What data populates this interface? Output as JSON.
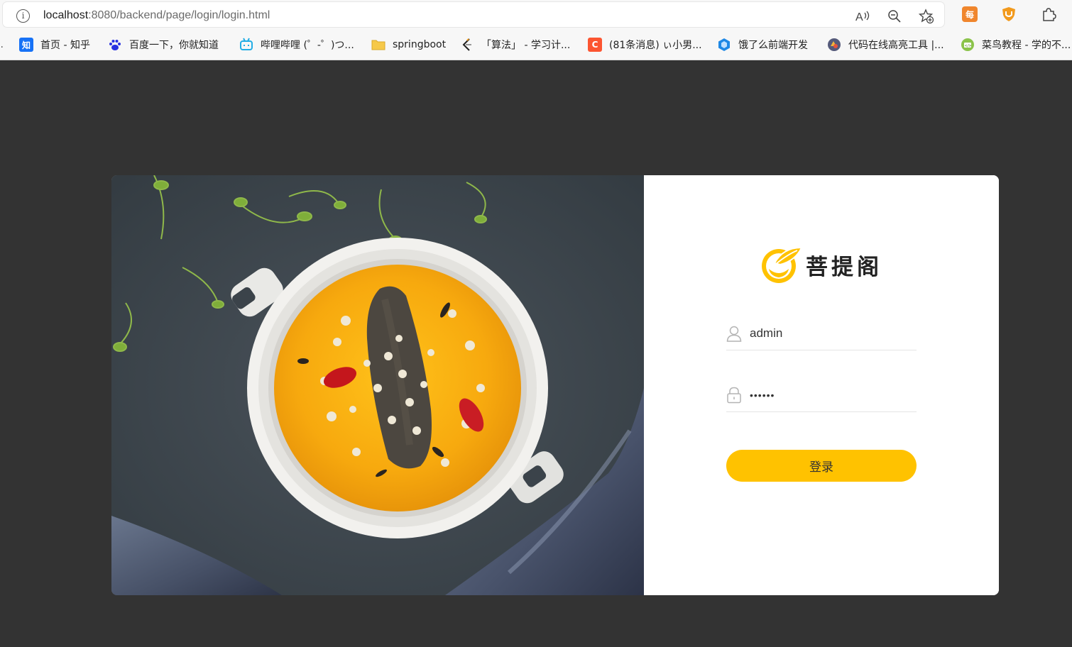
{
  "browser": {
    "url_host": "localhost",
    "url_path": ":8080/backend/page/login/login.html",
    "toolbar_icons": [
      "read-aloud-icon",
      "zoom-out-icon",
      "favorite-add-icon"
    ],
    "extensions": [
      {
        "name": "extension-every-icon",
        "glyph": "每",
        "color": "#f0862d"
      },
      {
        "name": "extension-shield-icon",
        "glyph": "",
        "color": "#f29a1d"
      },
      {
        "name": "extensions-puzzle-icon",
        "glyph": "",
        "color": "#444444"
      }
    ]
  },
  "bookmarks": [
    {
      "label": "首页 - 知乎",
      "icon": "zhihu-icon",
      "glyph": "知",
      "color": "#1772f6"
    },
    {
      "label": "百度一下，你就知道",
      "icon": "baidu-icon",
      "glyph": "",
      "color": "#2932e1"
    },
    {
      "label": "哔哩哔哩 (゜-゜)つ...",
      "icon": "bilibili-icon",
      "glyph": "",
      "color": "#23ade5"
    },
    {
      "label": "springboot",
      "icon": "folder-icon",
      "glyph": "",
      "color": "#f6c94a"
    },
    {
      "label": "「算法」 - 学习计...",
      "icon": "leetcode-icon",
      "glyph": "",
      "color": "#f89f1b"
    },
    {
      "label": "(81条消息) ぃ小男...",
      "icon": "csdn-icon",
      "glyph": "C",
      "color": "#fc5531"
    },
    {
      "label": "饿了么前端开发",
      "icon": "eleme-icon",
      "glyph": "",
      "color": "#1e88e5"
    },
    {
      "label": "代码在线高亮工具 |...",
      "icon": "code-highlight-icon",
      "glyph": "",
      "color": "#555a7a"
    },
    {
      "label": "菜鸟教程 - 学的不...",
      "icon": "runoob-icon",
      "glyph": "",
      "color": "#8bc34a"
    }
  ],
  "login": {
    "brand": "菩提阁",
    "username_value": "admin",
    "password_value": "123456",
    "submit_label": "登录",
    "accent_color": "#ffc200"
  }
}
